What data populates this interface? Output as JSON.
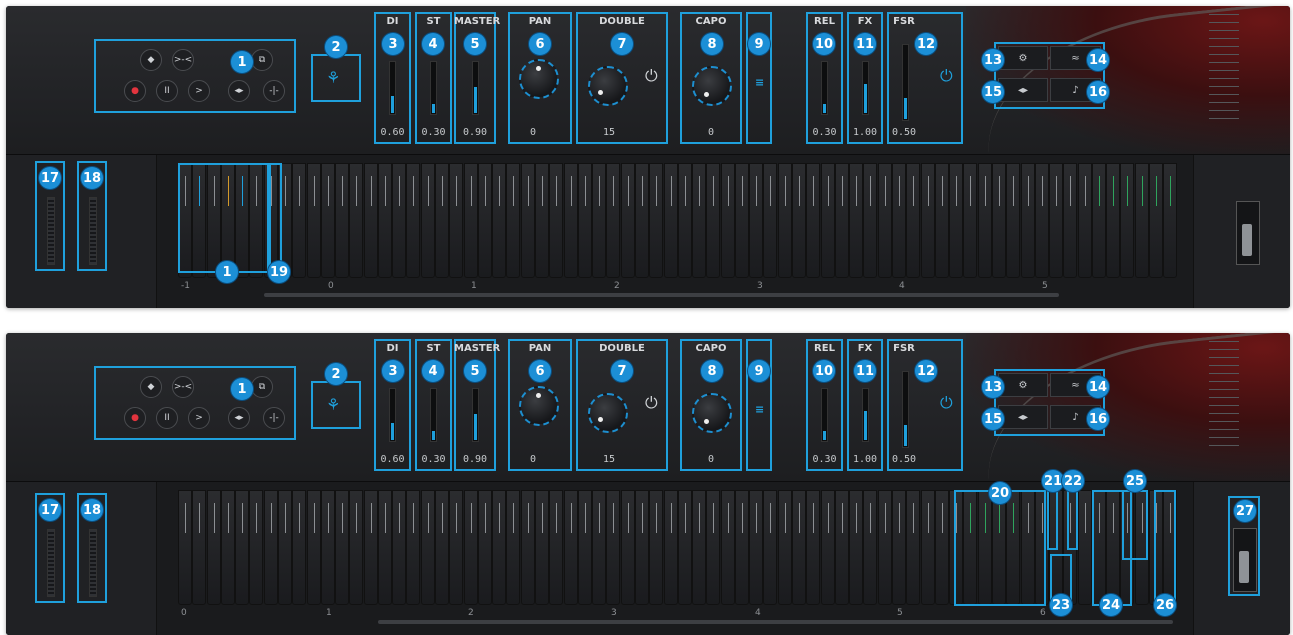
{
  "colors": {
    "highlight": "#1fa0dc",
    "badge": "#1c8fd6",
    "record": "#e2343e"
  },
  "controls": {
    "di": {
      "label": "DI",
      "value": "0.60",
      "level": 0.6
    },
    "st": {
      "label": "ST",
      "value": "0.30",
      "level": 0.3
    },
    "master": {
      "label": "MASTER",
      "value": "0.90",
      "level": 0.9
    },
    "pan": {
      "label": "PAN",
      "value": "0"
    },
    "double": {
      "label": "DOUBLE",
      "value": "15"
    },
    "capo": {
      "label": "CAPO",
      "value": "0"
    },
    "rel": {
      "label": "REL",
      "value": "0.30",
      "level": 0.3
    },
    "fx": {
      "label": "FX",
      "value": "1.00",
      "level": 1.0
    },
    "fsr": {
      "label": "FSR",
      "value": "0.50",
      "level": 0.5
    }
  },
  "transport": {
    "icons": [
      "stop-icon",
      "loop-icon",
      "duplicate-icon",
      "record-icon",
      "pause-icon",
      "play-icon",
      "swap-icon",
      "collapse-icon"
    ],
    "glyphs": [
      "◆",
      ">-<",
      "⧉",
      "●",
      "II",
      ">",
      "◂▸",
      "-|-"
    ]
  },
  "panel1": {
    "badges": [
      "1",
      "2",
      "3",
      "4",
      "5",
      "6",
      "7",
      "8",
      "9",
      "10",
      "11",
      "12",
      "13",
      "14",
      "15",
      "16",
      "17",
      "18",
      "1",
      "19"
    ],
    "octaves": [
      "-1",
      "0",
      "1",
      "2",
      "3",
      "4",
      "5"
    ]
  },
  "panel2": {
    "badges": [
      "1",
      "2",
      "3",
      "4",
      "5",
      "6",
      "7",
      "8",
      "9",
      "10",
      "11",
      "12",
      "13",
      "14",
      "15",
      "16",
      "17",
      "18",
      "20",
      "21",
      "22",
      "23",
      "24",
      "25",
      "26",
      "27"
    ],
    "octaves": [
      "0",
      "1",
      "2",
      "3",
      "4",
      "5",
      "6"
    ]
  }
}
